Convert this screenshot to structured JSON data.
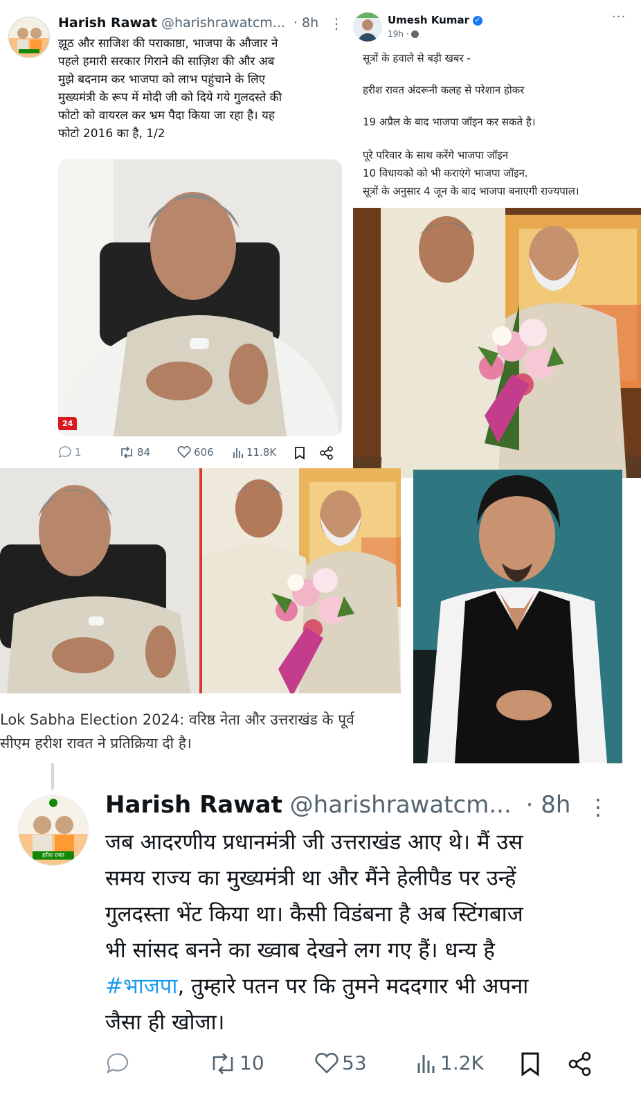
{
  "top_tweet": {
    "name": "Harish Rawat",
    "handle": "@harishrawatcm...",
    "time": "· 8h",
    "text_lines": [
      "झूठ और साजिश की पराकाष्ठा, भाजपा के औजार ने",
      "पहले हमारी सरकार गिराने की साज़िश की और अब",
      "मुझे बदनाम कर भाजपा को लाभ पहुंचाने के लिए",
      "मुख्यमंत्री के रूप में मोदी जी को दिये गये गुलदस्ते की",
      "फोटो को वायरल कर भ्रम पैदा किया जा रहा है। यह",
      "फोटो 2016 का है, 1/2"
    ],
    "photo_badge": "24",
    "actions": {
      "replies": "1",
      "retweets": "84",
      "likes": "606",
      "views": "11.8K"
    }
  },
  "fb_post": {
    "name": "Umesh Kumar",
    "time": "19h ·",
    "lines": [
      "सूत्रों के हवाले से बड़ी खबर -",
      "हरीश रावत अंदरूनी कलह से परेशान होकर",
      "19 अप्रैल के बाद भाजपा जॉइन कर सकते है।",
      "पूरे परिवार के साथ करेंगे भाजपा जॉइन",
      "10 विधायको को भी कराएंगे भाजपा जॉइन.",
      "सूत्रों के अनुसार 4 जून के बाद भाजपा बनाएगी राज्यपाल।"
    ]
  },
  "news_caption": {
    "line1": "Lok Sabha Election 2024: वरिष्ठ नेता और उत्तराखंड के पूर्व",
    "line2": "सीएम हरीश रावत ने प्रतिक्रिया दी है।"
  },
  "bottom_tweet": {
    "name": "Harish Rawat",
    "handle": "@harishrawatcm...",
    "time": "· 8h",
    "text_lines": [
      "जब आदरणीय प्रधानमंत्री जी उत्तराखंड आए थे। मैं उस",
      "समय राज्य का मुख्यमंत्री था और मैंने हेलीपैड पर उन्हें",
      "गुलदस्ता भेंट किया था। कैसी विडंबना है अब स्टिंगबाज",
      "भी सांसद बनने का ख्वाब देखने लग गए हैं। धन्य है"
    ],
    "hashtag": "#भाजपा",
    "line5_rest": ", तुम्हारे पतन पर कि तुमने मददगार भी अपना",
    "line6": "जैसा ही खोजा।",
    "avatar_caption": "हरीश रावत",
    "actions": {
      "retweets": "10",
      "likes": "53",
      "views": "1.2K"
    }
  },
  "colors": {
    "link": "#1d9bf0",
    "muted": "#536471",
    "fb_verified": "#1877f2",
    "congress_green": "#138808",
    "saffron": "#ff9933"
  }
}
